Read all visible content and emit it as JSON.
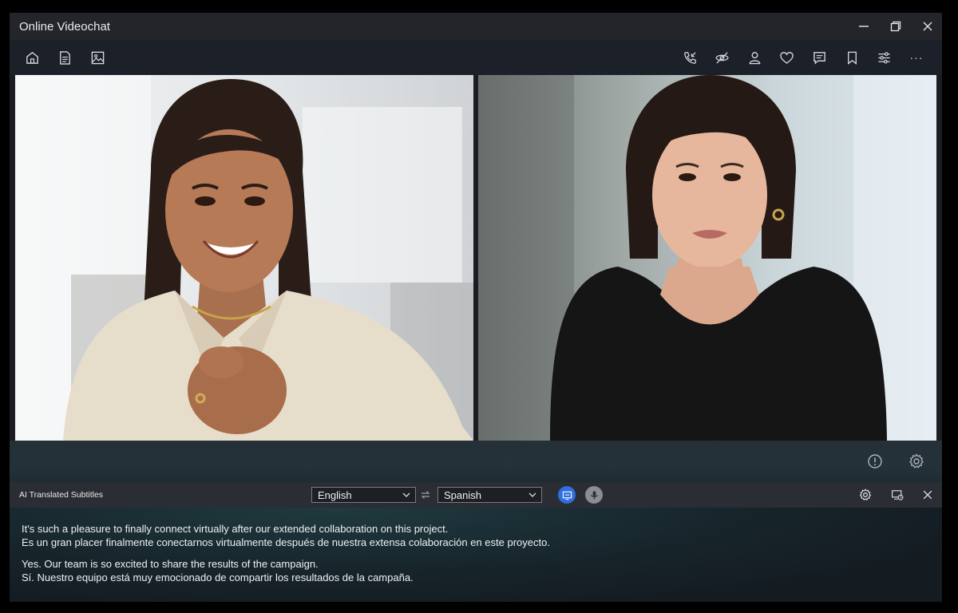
{
  "window": {
    "title": "Online Videochat"
  },
  "toolbar": {
    "left_icons": [
      "home-icon",
      "document-icon",
      "image-icon"
    ],
    "right_icons": [
      "phone-incoming-icon",
      "eye-off-icon",
      "user-icon",
      "heart-icon",
      "message-icon",
      "bookmark-icon",
      "sliders-icon",
      "more-icon"
    ],
    "more_label": "···"
  },
  "subtitle_bar": {
    "label": "AI Translated Subtitles",
    "source_language": "English",
    "target_language": "Spanish"
  },
  "subtitles": [
    {
      "original": "It's such a pleasure to finally connect virtually after our extended collaboration on this project.",
      "translation": "Es un gran placer finalmente conectarnos virtualmente después de nuestra extensa colaboración en este proyecto."
    },
    {
      "original": "Yes. Our team is so excited to share the results of the campaign.",
      "translation": "Sí. Nuestro equipo está muy emocionado de compartir los resultados de la campaña."
    }
  ],
  "colors": {
    "accent": "#2f6fe0",
    "window_bg": "#1b1d22",
    "titlebar": "#23252a",
    "subtitle_bar": "#2a2d33"
  }
}
